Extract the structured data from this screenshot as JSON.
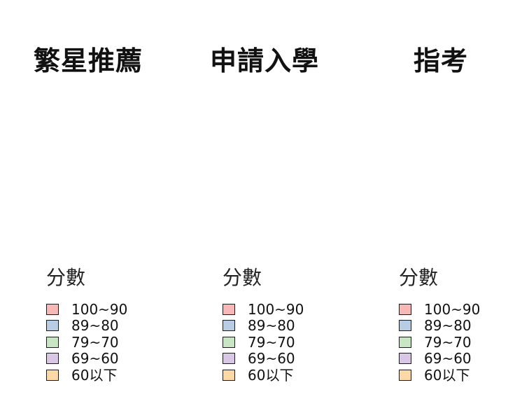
{
  "columns": [
    {
      "title": "繁星推薦",
      "legend": {
        "title": "分數",
        "items": [
          {
            "label": "100~90",
            "color": "#f8b8b8"
          },
          {
            "label": "89~80",
            "color": "#b8cce4"
          },
          {
            "label": "79~70",
            "color": "#c8e6c4"
          },
          {
            "label": "69~60",
            "color": "#d8c8e6"
          },
          {
            "label": "60以下",
            "color": "#fcd8a4"
          }
        ]
      }
    },
    {
      "title": "申請入學",
      "legend": {
        "title": "分數",
        "items": [
          {
            "label": "100~90",
            "color": "#f8b8b8"
          },
          {
            "label": "89~80",
            "color": "#b8cce4"
          },
          {
            "label": "79~70",
            "color": "#c8e6c4"
          },
          {
            "label": "69~60",
            "color": "#d8c8e6"
          },
          {
            "label": "60以下",
            "color": "#fcd8a4"
          }
        ]
      }
    },
    {
      "title": "指考",
      "legend": {
        "title": "分數",
        "items": [
          {
            "label": "100~90",
            "color": "#f8b8b8"
          },
          {
            "label": "89~80",
            "color": "#b8cce4"
          },
          {
            "label": "79~70",
            "color": "#c8e6c4"
          },
          {
            "label": "69~60",
            "color": "#d8c8e6"
          },
          {
            "label": "60以下",
            "color": "#fcd8a4"
          }
        ]
      }
    }
  ]
}
